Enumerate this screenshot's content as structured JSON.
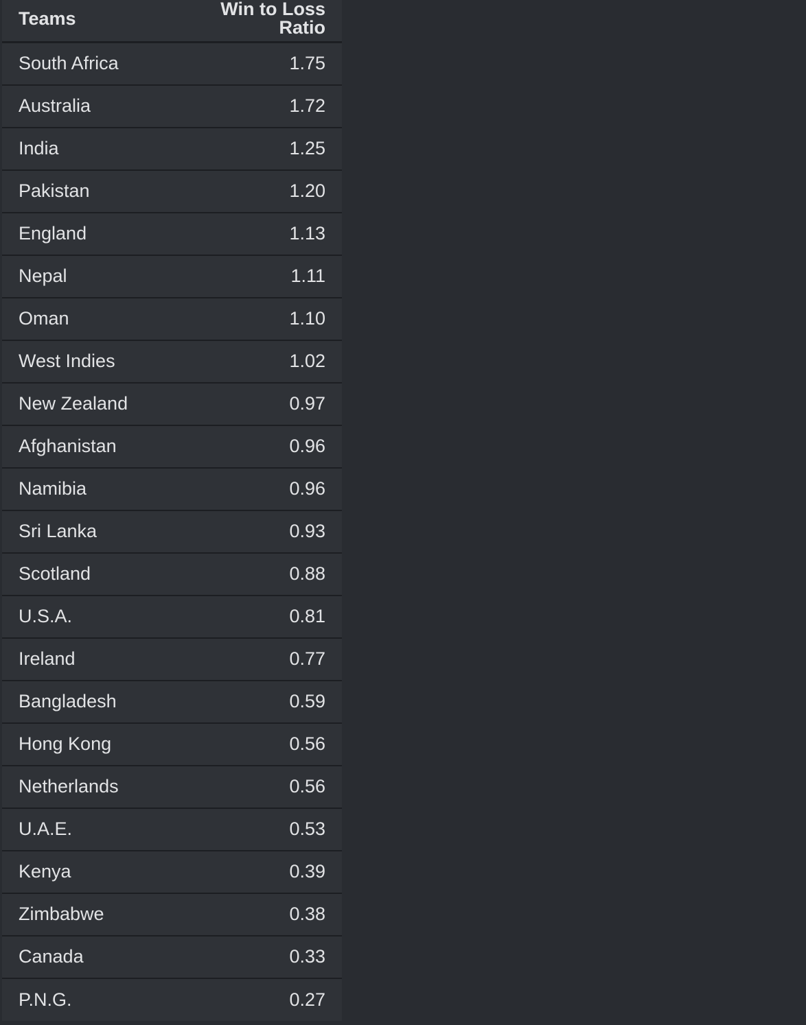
{
  "table": {
    "headers": {
      "team": "Teams",
      "ratio": "Win to Loss Ratio"
    },
    "rows": [
      {
        "team": "South Africa",
        "ratio": "1.75"
      },
      {
        "team": "Australia",
        "ratio": "1.72"
      },
      {
        "team": "India",
        "ratio": "1.25"
      },
      {
        "team": "Pakistan",
        "ratio": "1.20"
      },
      {
        "team": "England",
        "ratio": "1.13"
      },
      {
        "team": "Nepal",
        "ratio": "1.11"
      },
      {
        "team": "Oman",
        "ratio": "1.10"
      },
      {
        "team": "West Indies",
        "ratio": "1.02"
      },
      {
        "team": "New Zealand",
        "ratio": "0.97"
      },
      {
        "team": "Afghanistan",
        "ratio": "0.96"
      },
      {
        "team": "Namibia",
        "ratio": "0.96"
      },
      {
        "team": "Sri Lanka",
        "ratio": "0.93"
      },
      {
        "team": "Scotland",
        "ratio": "0.88"
      },
      {
        "team": "U.S.A.",
        "ratio": "0.81"
      },
      {
        "team": "Ireland",
        "ratio": "0.77"
      },
      {
        "team": "Bangladesh",
        "ratio": "0.59"
      },
      {
        "team": "Hong Kong",
        "ratio": "0.56"
      },
      {
        "team": "Netherlands",
        "ratio": "0.56"
      },
      {
        "team": "U.A.E.",
        "ratio": "0.53"
      },
      {
        "team": "Kenya",
        "ratio": "0.39"
      },
      {
        "team": "Zimbabwe",
        "ratio": "0.38"
      },
      {
        "team": "Canada",
        "ratio": "0.33"
      },
      {
        "team": "P.N.G.",
        "ratio": "0.27"
      }
    ]
  },
  "colors": {
    "background": "#292c31",
    "row_background": "#2f3237",
    "row_divider": "#1c1e22",
    "text": "#e2e3e5"
  }
}
